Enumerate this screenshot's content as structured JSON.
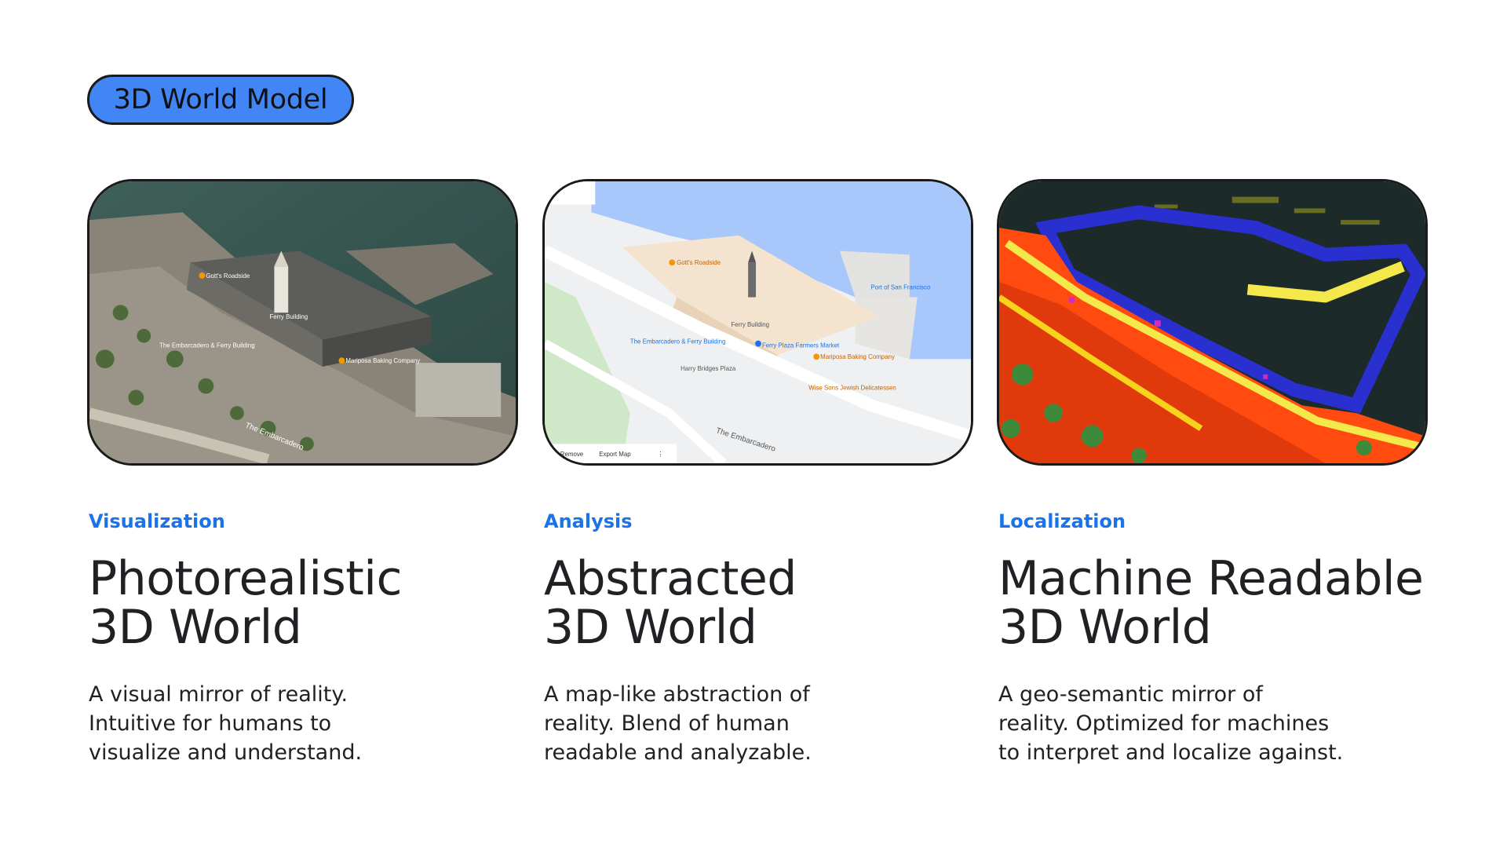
{
  "header": {
    "badge_label": "3D World Model"
  },
  "colors": {
    "accent_blue": "#4285f4",
    "eyebrow_blue": "#1a73e8",
    "text": "#202124"
  },
  "cards": [
    {
      "image": "aerial-photo-of-waterfront-pier-building",
      "eyebrow": "Visualization",
      "title_line1": "Photorealistic",
      "title_line2": "3D World",
      "desc_line1": "A visual mirror of reality.",
      "desc_line2": "Intuitive for humans to",
      "desc_line3": "visualize and understand.",
      "map_labels": {
        "building": "Ferry Building",
        "poi1": "Gott's Roadside",
        "poi2": "Mariposa Baking Company",
        "poi3": "The Embarcadero & Ferry Building",
        "street": "The Embarcadero"
      }
    },
    {
      "image": "abstract-map-of-waterfront-pier-building",
      "eyebrow": "Analysis",
      "title_line1": "Abstracted",
      "title_line2": "3D World",
      "desc_line1": "A map-like abstraction of",
      "desc_line2": "reality. Blend of human",
      "desc_line3": "readable and analyzable.",
      "map_labels": {
        "building": "Ferry Building",
        "poi1": "Gott's Roadside",
        "poi2": "Ferry Plaza Farmers Market",
        "poi3": "Mariposa Baking Company",
        "poi4": "Port of San Francisco",
        "poi5": "The Embarcadero & Ferry Building",
        "poi6": "Harry Bridges Plaza",
        "poi7": "Wise Sons Jewish Delicatessen",
        "street": "The Embarcadero",
        "btn_remove": "Remove",
        "btn_export": "Export Map",
        "btn_more": "⋮"
      }
    },
    {
      "image": "semantic-point-cloud-of-waterfront",
      "eyebrow": "Localization",
      "title_line1": "Machine Readable",
      "title_line2": "3D World",
      "desc_line1": "A geo-semantic mirror of",
      "desc_line2": "reality. Optimized for machines",
      "desc_line3": "to interpret and localize against."
    }
  ]
}
